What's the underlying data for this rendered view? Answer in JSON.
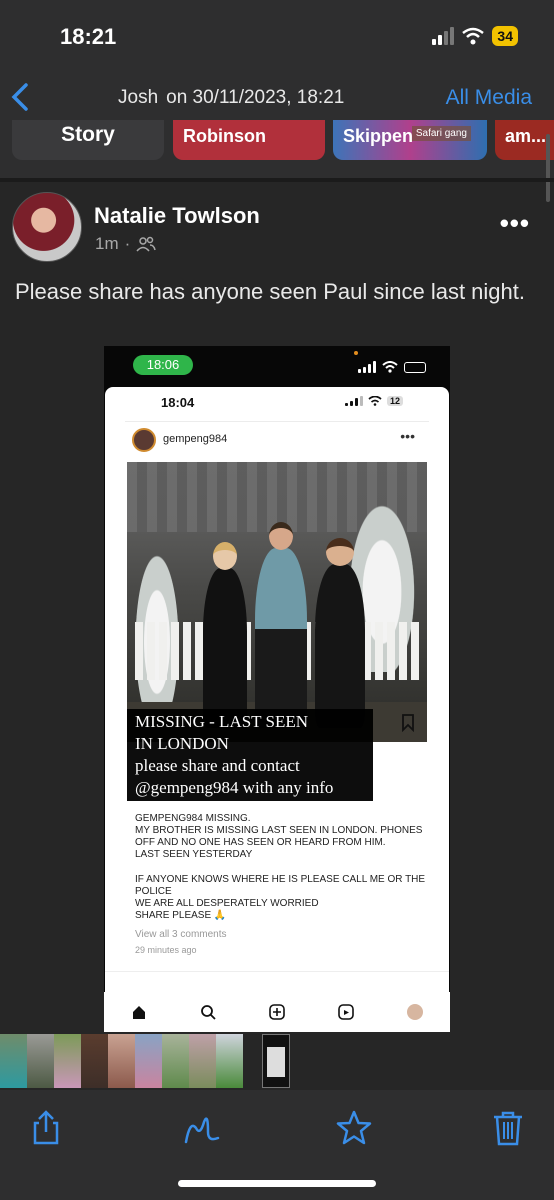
{
  "status_bar": {
    "time": "18:21",
    "battery": "34"
  },
  "nav": {
    "back_icon": "chevron-left-icon",
    "contact": "Josh",
    "context": "on 30/11/2023, 18:21",
    "all_media": "All Media"
  },
  "stories": [
    {
      "label": "Story"
    },
    {
      "label": "Robinson"
    },
    {
      "label": "Skippen",
      "tag": "Safari gang"
    },
    {
      "label": "am..."
    }
  ],
  "post": {
    "author": "Natalie Towlson",
    "time": "1m",
    "separator": "·",
    "audience_icon": "friends-icon",
    "more_icon": "more-horizontal-icon",
    "text": "Please share has anyone seen Paul since last night."
  },
  "embedded_screenshot": {
    "outer_time": "18:06",
    "inner_time": "18:04",
    "inner_battery": "12",
    "username": "gempeng984",
    "overlay_lines": [
      "MISSING - LAST SEEN",
      "IN LONDON",
      "please share and contact",
      "@gempeng984 with any info"
    ],
    "caption_lines": [
      "gempeng984 MISSING.",
      "MY BROTHER IS MISSING LAST SEEN IN LONDON.  PHONES OFF AND NO ONE HAS SEEN OR HEARD FROM HIM.",
      "LAST SEEN YESTERDAY",
      "",
      "IF ANYONE KNOWS WHERE HE IS PLEASE CALL ME OR THE POLICE",
      "WE ARE ALL DESPERATELY WORRIED",
      "SHARE PLEASE 🙏"
    ],
    "view_comments": "View all 3 comments",
    "ago": "29 minutes ago"
  },
  "toolbar": {
    "share_icon": "share-icon",
    "markup_icon": "markup-icon",
    "star_icon": "star-icon",
    "trash_icon": "trash-icon"
  },
  "colors": {
    "accent": "#3a8ee8",
    "background": "#262626",
    "bar": "#2e2e2f"
  }
}
